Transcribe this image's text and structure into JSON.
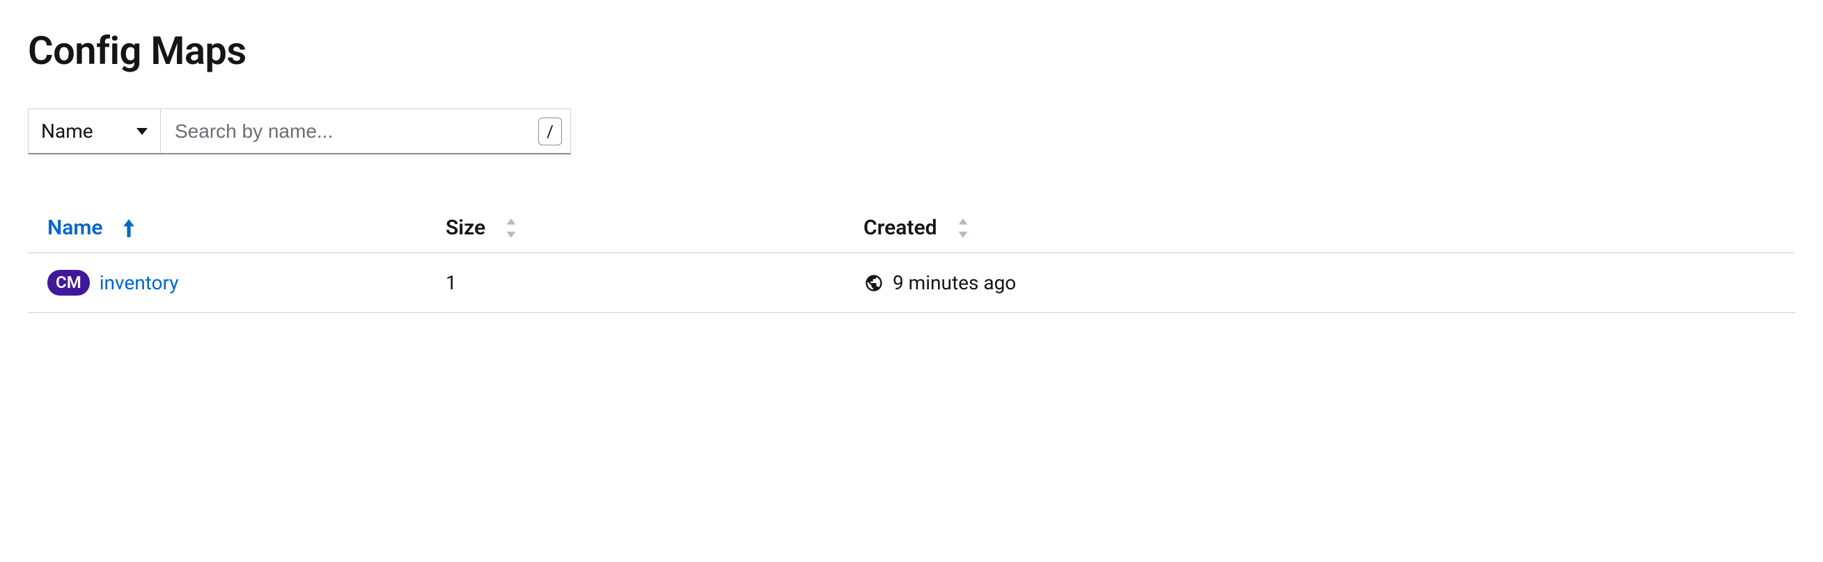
{
  "page": {
    "title": "Config Maps"
  },
  "filter": {
    "dropdown_label": "Name",
    "search_placeholder": "Search by name...",
    "shortcut_key": "/"
  },
  "table": {
    "columns": {
      "name": "Name",
      "size": "Size",
      "created": "Created"
    },
    "rows": [
      {
        "badge": "CM",
        "name": "inventory",
        "size": "1",
        "created": "9 minutes ago"
      }
    ]
  }
}
